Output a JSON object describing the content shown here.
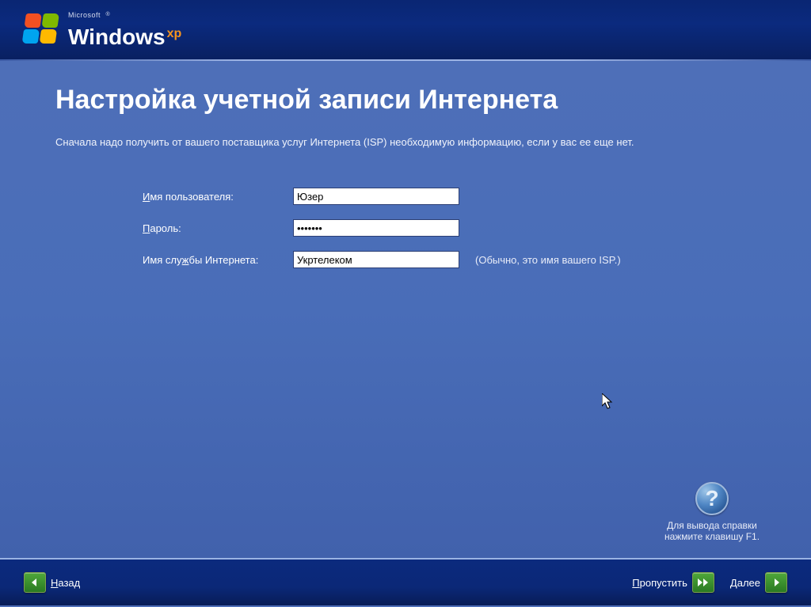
{
  "header": {
    "brand_company_prefix": "Microsoft",
    "brand_name": "Windows",
    "brand_suffix": "xp"
  },
  "page": {
    "title": "Настройка учетной записи Интернета",
    "subtitle": "Сначала надо получить от вашего поставщика услуг Интернета (ISP) необходимую информацию, если у вас ее еще нет."
  },
  "form": {
    "username_label_pre": "И",
    "username_label_rest": "мя пользователя:",
    "username_value": "Юзер",
    "password_label_pre": "П",
    "password_label_rest": "ароль:",
    "password_value": "•••••••",
    "isp_label_pre": "Имя слу",
    "isp_label_u": "ж",
    "isp_label_rest": "бы Интернета:",
    "isp_value": "Укртелеком",
    "isp_hint": "(Обычно, это имя вашего ISP.)"
  },
  "help": {
    "line1": "Для вывода справки",
    "line2": "нажмите клавишу F1."
  },
  "footer": {
    "back_u": "Н",
    "back_rest": "азад",
    "skip_u": "П",
    "skip_rest": "ропустить",
    "next_u": "Д",
    "next_rest": "алее"
  }
}
